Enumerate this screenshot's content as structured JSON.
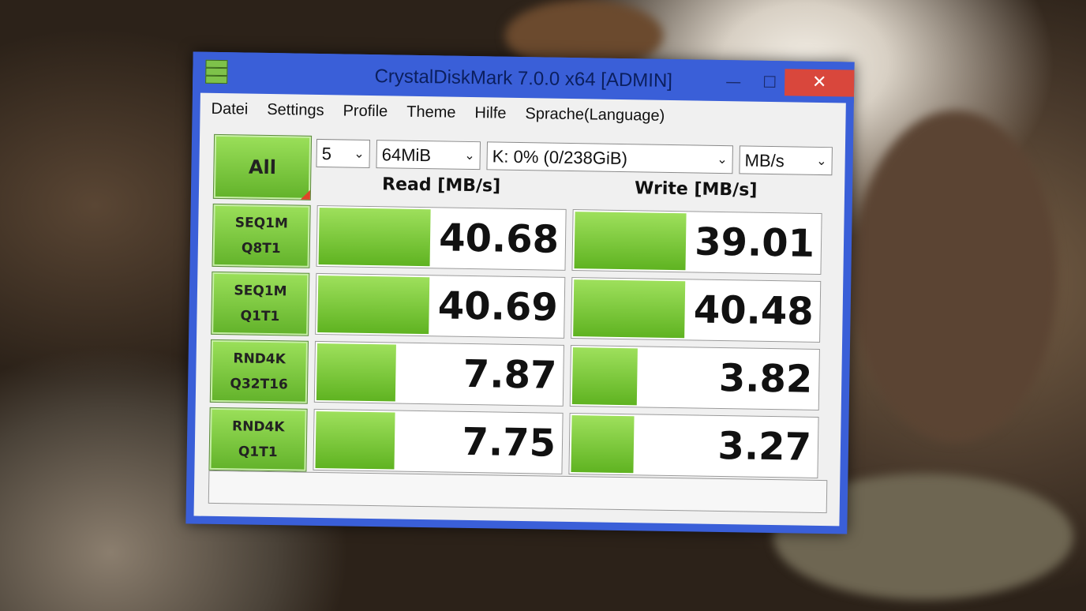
{
  "window": {
    "title": "CrystalDiskMark 7.0.0 x64 [ADMIN]",
    "minimize_glyph": "—",
    "maximize_glyph": "☐",
    "close_glyph": "✕"
  },
  "menu": [
    "Datei",
    "Settings",
    "Profile",
    "Theme",
    "Hilfe",
    "Sprache(Language)"
  ],
  "controls": {
    "all_label": "All",
    "count": "5",
    "size": "64MiB",
    "drive": "K: 0% (0/238GiB)",
    "unit": "MB/s"
  },
  "headers": {
    "read": "Read [MB/s]",
    "write": "Write [MB/s]"
  },
  "tests": [
    {
      "line1": "SEQ1M",
      "line2": "Q8T1",
      "read": "40.68",
      "write": "39.01",
      "read_fill": 0.45,
      "write_fill": 0.45
    },
    {
      "line1": "SEQ1M",
      "line2": "Q1T1",
      "read": "40.69",
      "write": "40.48",
      "read_fill": 0.45,
      "write_fill": 0.45
    },
    {
      "line1": "RND4K",
      "line2": "Q32T16",
      "read": "7.87",
      "write": "3.82",
      "read_fill": 0.32,
      "write_fill": 0.26
    },
    {
      "line1": "RND4K",
      "line2": "Q1T1",
      "read": "7.75",
      "write": "3.27",
      "read_fill": 0.32,
      "write_fill": 0.25
    }
  ],
  "status_text": "",
  "colors": {
    "accent_green": "#62b22a",
    "title_blue": "#3a5fd8",
    "close_red": "#d9473c"
  }
}
